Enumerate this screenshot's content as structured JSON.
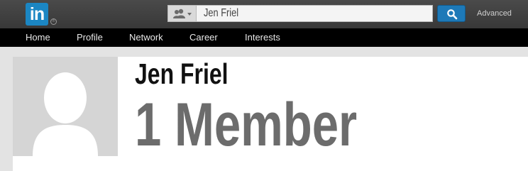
{
  "header": {
    "logo_text": "in",
    "logo_reg": "®",
    "search_type_icon": "people-icon",
    "search_value": "Jen Friel",
    "search_button_icon": "search-icon",
    "advanced_label": "Advanced"
  },
  "nav": {
    "items": [
      {
        "label": "Home"
      },
      {
        "label": "Profile"
      },
      {
        "label": "Network"
      },
      {
        "label": "Career"
      },
      {
        "label": "Interests"
      }
    ]
  },
  "profile": {
    "name": "Jen Friel",
    "member_count": "1 Member",
    "avatar_icon": "default-person-icon"
  },
  "colors": {
    "brand": "#1b86c3",
    "topbar": "#3f3f3f",
    "navbar": "#000000",
    "search_button": "#1d79b8"
  }
}
